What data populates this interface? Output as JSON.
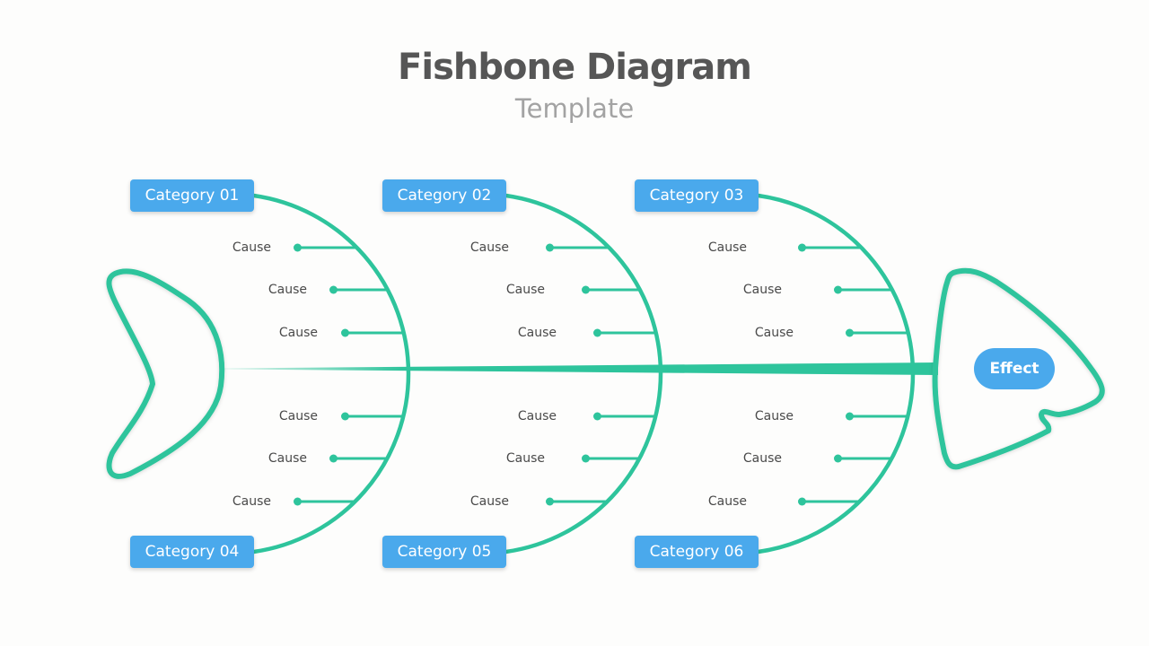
{
  "header": {
    "title": "Fishbone Diagram",
    "subtitle": "Template"
  },
  "effect": {
    "label": "Effect"
  },
  "categories": [
    {
      "label": "Category 01",
      "causes": [
        "Cause",
        "Cause",
        "Cause"
      ]
    },
    {
      "label": "Category 02",
      "causes": [
        "Cause",
        "Cause",
        "Cause"
      ]
    },
    {
      "label": "Category 03",
      "causes": [
        "Cause",
        "Cause",
        "Cause"
      ]
    },
    {
      "label": "Category 04",
      "causes": [
        "Cause",
        "Cause",
        "Cause"
      ]
    },
    {
      "label": "Category 05",
      "causes": [
        "Cause",
        "Cause",
        "Cause"
      ]
    },
    {
      "label": "Category 06",
      "causes": [
        "Cause",
        "Cause",
        "Cause"
      ]
    }
  ],
  "colors": {
    "bone": "#2ec49c",
    "box": "#4aa9ec",
    "title": "#565656",
    "subtitle": "#a3a3a3"
  }
}
